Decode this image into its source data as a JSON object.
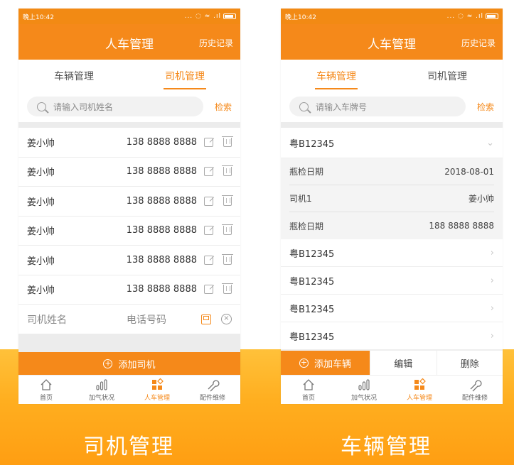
{
  "left_phone": {
    "status": {
      "time": "晚上10:42",
      "icons": "... ◌ ≈ .ıl"
    },
    "navbar": {
      "title": "人车管理",
      "history": "历史记录"
    },
    "tabs": [
      {
        "label": "车辆管理",
        "active": false
      },
      {
        "label": "司机管理",
        "active": true
      }
    ],
    "search": {
      "placeholder": "请输入司机姓名",
      "button": "检索"
    },
    "drivers": [
      {
        "name": "姜小帅",
        "phone": "138 8888 8888"
      },
      {
        "name": "姜小帅",
        "phone": "138 8888 8888"
      },
      {
        "name": "姜小帅",
        "phone": "138 8888 8888"
      },
      {
        "name": "姜小帅",
        "phone": "138 8888 8888"
      },
      {
        "name": "姜小帅",
        "phone": "138 8888 8888"
      },
      {
        "name": "姜小帅",
        "phone": "138 8888 8888"
      }
    ],
    "new_row": {
      "name_placeholder": "司机姓名",
      "phone_placeholder": "电话号码"
    },
    "add_button": "添加司机",
    "tabbar": [
      {
        "label": "首页",
        "icon": "home-icon"
      },
      {
        "label": "加气状况",
        "icon": "bar-chart-icon"
      },
      {
        "label": "人车管理",
        "icon": "grid-icon",
        "active": true
      },
      {
        "label": "配件维修",
        "icon": "wrench-icon"
      }
    ]
  },
  "right_phone": {
    "status": {
      "time": "晚上10:42",
      "icons": "... ◌ ≈ .ıl"
    },
    "navbar": {
      "title": "人车管理",
      "history": "历史记录"
    },
    "tabs": [
      {
        "label": "车辆管理",
        "active": true
      },
      {
        "label": "司机管理",
        "active": false
      }
    ],
    "search": {
      "placeholder": "请输入车牌号",
      "button": "检索"
    },
    "expanded_vehicle": {
      "plate": "粤B12345",
      "details": [
        {
          "label": "瓶检日期",
          "value": "2018-08-01"
        },
        {
          "label": "司机1",
          "value": "姜小帅"
        },
        {
          "label": "瓶检日期",
          "value": "188 8888 8888"
        }
      ]
    },
    "vehicles": [
      "粤B12345",
      "粤B12345",
      "粤B12345",
      "粤B12345"
    ],
    "actions": {
      "add": "添加车辆",
      "edit": "编辑",
      "delete": "删除"
    },
    "tabbar": [
      {
        "label": "首页",
        "icon": "home-icon"
      },
      {
        "label": "加气状况",
        "icon": "bar-chart-icon"
      },
      {
        "label": "人车管理",
        "icon": "grid-icon",
        "active": true
      },
      {
        "label": "配件维修",
        "icon": "wrench-icon"
      }
    ]
  },
  "captions": {
    "left": "司机管理",
    "right": "车辆管理"
  },
  "colors": {
    "accent": "#f5891a",
    "band": "#ffae1f"
  }
}
